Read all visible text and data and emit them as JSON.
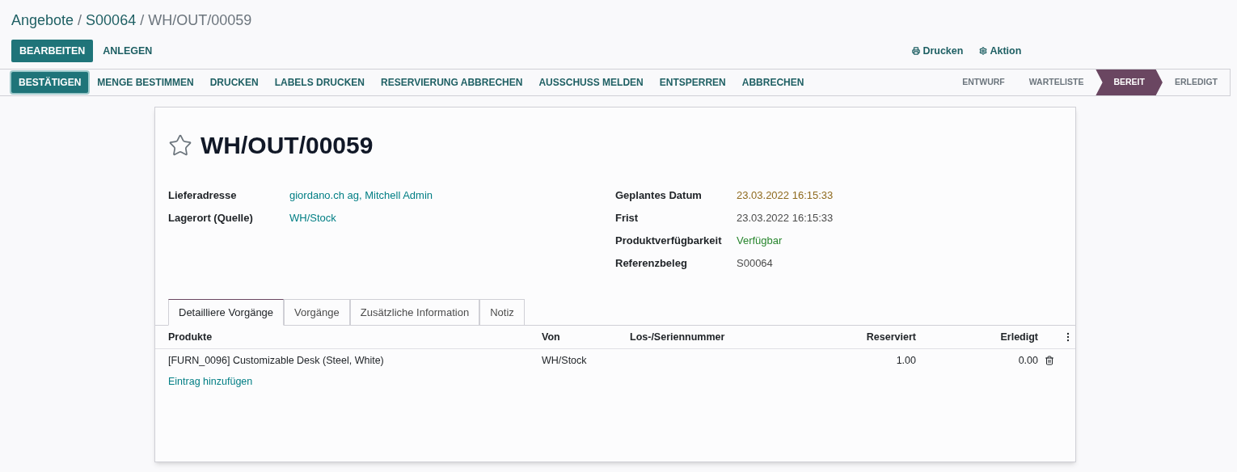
{
  "breadcrumb": [
    {
      "label": "Angebote",
      "link": true
    },
    {
      "label": "/",
      "link": false
    },
    {
      "label": "S00064",
      "link": true
    },
    {
      "label": "/",
      "link": false
    },
    {
      "label": "WH/OUT/00059",
      "link": false
    }
  ],
  "control_buttons": [
    {
      "label": "BEARBEITEN",
      "primary": true
    },
    {
      "label": "ANLEGEN",
      "primary": false
    }
  ],
  "action_menus": [
    {
      "kind": "print",
      "label": "Drucken"
    },
    {
      "kind": "gear",
      "label": "Aktion"
    }
  ],
  "header_buttons": [
    {
      "label": "BESTÄTIGEN",
      "primary": true
    },
    {
      "label": "MENGE BESTIMMEN",
      "primary": false
    },
    {
      "label": "DRUCKEN",
      "primary": false
    },
    {
      "label": "LABELS DRUCKEN",
      "primary": false
    },
    {
      "label": "RESERVIERUNG ABBRECHEN",
      "primary": false
    },
    {
      "label": "AUSSCHUSS MELDEN",
      "primary": false
    },
    {
      "label": "ENTSPERREN",
      "primary": false
    },
    {
      "label": "ABBRECHEN",
      "primary": false
    }
  ],
  "status_stages": [
    {
      "label": "ENTWURF",
      "selected": false
    },
    {
      "label": "WARTELISTE",
      "selected": false
    },
    {
      "label": "BEREIT",
      "selected": true
    },
    {
      "label": "ERLEDIGT",
      "selected": false
    }
  ],
  "record": {
    "title": "WH/OUT/00059",
    "favorite": false
  },
  "left_fields": [
    {
      "label": "Lieferadresse",
      "value": "giordano.ch ag, Mitchell Admin",
      "kind": "link"
    },
    {
      "label": "Lagerort (Quelle)",
      "value": "WH/Stock",
      "kind": "link"
    }
  ],
  "right_fields": [
    {
      "label": "Geplantes Datum",
      "value": "23.03.2022 16:15:33",
      "kind": "warning"
    },
    {
      "label": "Frist",
      "value": "23.03.2022 16:15:33",
      "kind": "plain"
    },
    {
      "label": "Produktverfügbarkeit",
      "value": "Verfügbar",
      "kind": "success"
    },
    {
      "label": "Referenzbeleg",
      "value": "S00064",
      "kind": "plain"
    }
  ],
  "tabs": [
    {
      "label": "Detailliere Vorgänge",
      "selected": true
    },
    {
      "label": "Vorgänge",
      "selected": false
    },
    {
      "label": "Zusätzliche Information",
      "selected": false
    },
    {
      "label": "Notiz",
      "selected": false
    }
  ],
  "table": {
    "columns": [
      "Produkte",
      "Von",
      "Los-/Seriennummer",
      "Reserviert",
      "Erledigt"
    ],
    "rows": [
      [
        "[FURN_0096] Customizable Desk (Steel, White)",
        "WH/Stock",
        "",
        "1.00",
        "0.00"
      ]
    ],
    "add_line": "Eintrag hinzufügen"
  }
}
